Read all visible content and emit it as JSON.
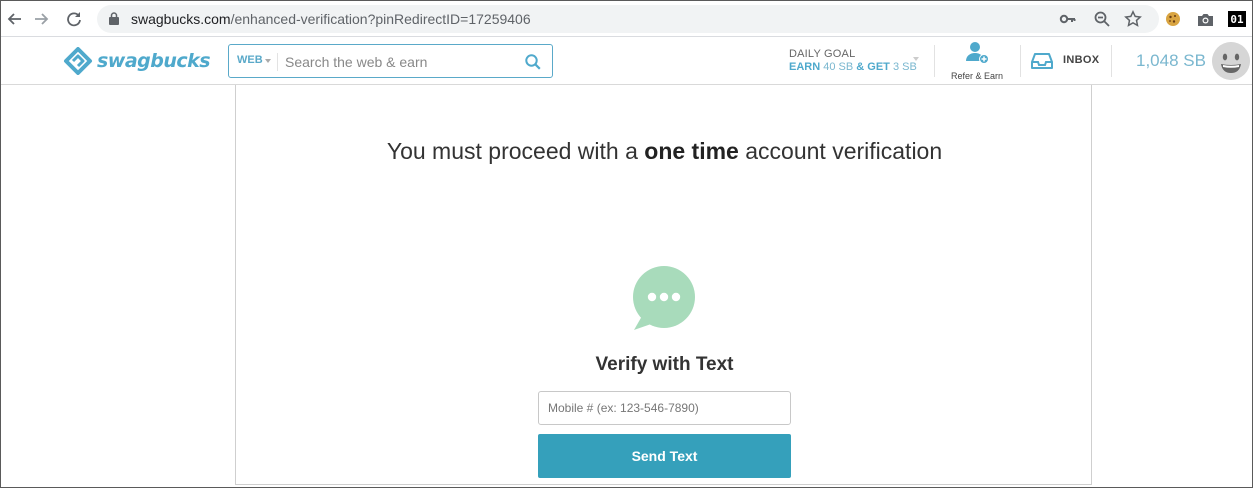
{
  "browser": {
    "url_host": "swagbucks.com",
    "url_path": "/enhanced-verification?pinRedirectID=17259406",
    "extension_badge": "01",
    "icons": [
      "back-arrow-icon",
      "forward-arrow-icon",
      "reload-icon",
      "lock-icon",
      "key-icon",
      "zoom-icon",
      "star-icon",
      "cookie-icon",
      "camera-icon"
    ]
  },
  "header": {
    "logo_text": "swagbucks",
    "search": {
      "scope": "WEB",
      "placeholder": "Search the web & earn",
      "value": ""
    },
    "daily_goal": {
      "title": "DAILY GOAL",
      "earn_label": "EARN",
      "earn_value": "40 SB",
      "get_label": "& GET",
      "get_value": "3 SB"
    },
    "refer_label": "Refer & Earn",
    "inbox_label": "INBOX",
    "balance": "1,048 SB"
  },
  "main": {
    "headline_pre": "You must proceed with a",
    "headline_bold": "one time",
    "headline_post": "account verification",
    "verify_title": "Verify with Text",
    "phone_placeholder": "Mobile # (ex: 123-546-7890)",
    "phone_value": "",
    "send_button": "Send Text"
  },
  "colors": {
    "brand": "#4fa9cc",
    "button": "#35a0bb",
    "chat_icon": "#a8dbbb"
  }
}
